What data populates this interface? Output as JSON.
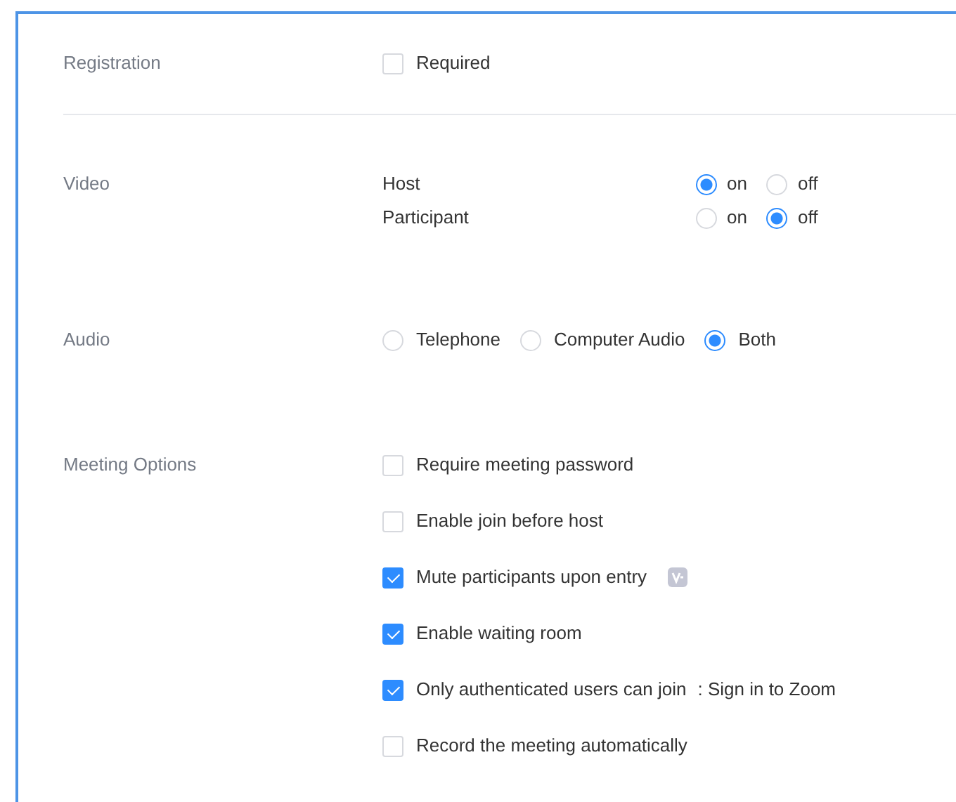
{
  "registration": {
    "label": "Registration",
    "option": {
      "label": "Required",
      "checked": false
    }
  },
  "video": {
    "label": "Video",
    "rows": [
      {
        "label": "Host",
        "options": [
          {
            "label": "on",
            "selected": true
          },
          {
            "label": "off",
            "selected": false
          }
        ]
      },
      {
        "label": "Participant",
        "options": [
          {
            "label": "on",
            "selected": false
          },
          {
            "label": "off",
            "selected": true
          }
        ]
      }
    ]
  },
  "audio": {
    "label": "Audio",
    "options": [
      {
        "label": "Telephone",
        "selected": false
      },
      {
        "label": "Computer Audio",
        "selected": false
      },
      {
        "label": "Both",
        "selected": true
      }
    ]
  },
  "meeting_options": {
    "label": "Meeting Options",
    "items": [
      {
        "label": "Require meeting password",
        "checked": false
      },
      {
        "label": "Enable join before host",
        "checked": false
      },
      {
        "label": "Mute participants upon entry",
        "checked": true,
        "badge_icon": true
      },
      {
        "label": "Enable waiting room",
        "checked": true
      },
      {
        "label": "Only authenticated users can join",
        "checked": true,
        "note": ": Sign in to Zoom"
      },
      {
        "label": "Record the meeting automatically",
        "checked": false
      }
    ]
  }
}
